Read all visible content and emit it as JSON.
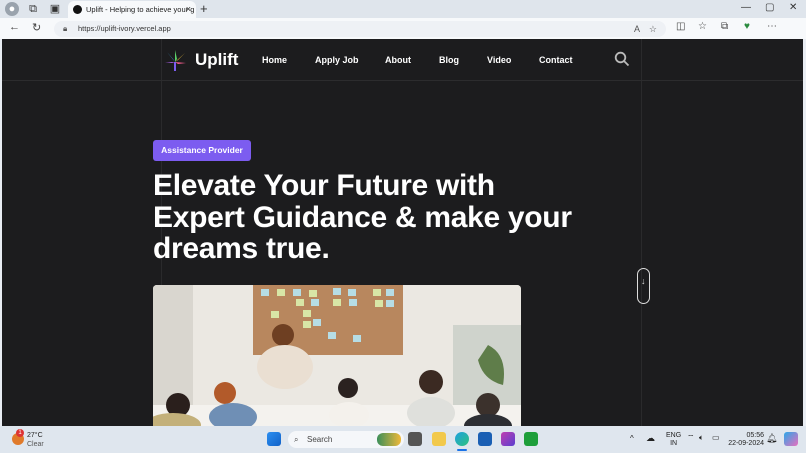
{
  "browser": {
    "tab_title": "Uplift - Helping to achieve your g",
    "tab_close": "×",
    "new_tab": "+",
    "url": "https://uplift-ivory.vercel.app",
    "win_minimize": "—",
    "win_restore": "▢",
    "win_close": "✕"
  },
  "site": {
    "brand": "Uplift",
    "nav": [
      "Home",
      "Apply Job",
      "About",
      "Blog",
      "Video",
      "Contact"
    ],
    "badge": "Assistance Provider",
    "headline": [
      "Elevate Your Future with",
      "Expert Guidance & make your",
      "dreams true."
    ]
  },
  "taskbar": {
    "weather_temp": "27°C",
    "weather_text": "Clear",
    "weather_alert": "1",
    "search_placeholder": "Search",
    "lang_1": "ENG",
    "lang_2": "IN",
    "time": "05:56",
    "date": "22-09-2024"
  },
  "colors": {
    "accent": "#7c5cf0",
    "page_bg": "#1c1c1e"
  }
}
